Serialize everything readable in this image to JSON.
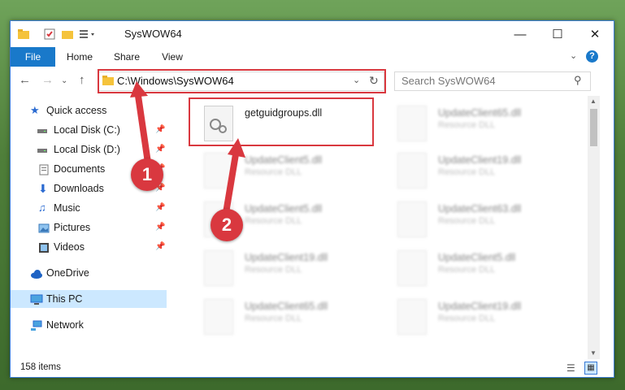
{
  "window": {
    "title": "SysWOW64"
  },
  "ribbon": {
    "tabs": [
      "File",
      "Home",
      "Share",
      "View"
    ]
  },
  "address": {
    "path": "C:\\Windows\\SysWOW64"
  },
  "search": {
    "placeholder": "Search SysWOW64"
  },
  "sidebar": {
    "items": [
      {
        "label": "Quick access",
        "icon": "star-icon",
        "pinned": false
      },
      {
        "label": "Local Disk (C:)",
        "icon": "drive-icon",
        "pinned": true
      },
      {
        "label": "Local Disk (D:)",
        "icon": "drive-icon",
        "pinned": true
      },
      {
        "label": "Documents",
        "icon": "document-icon",
        "pinned": true
      },
      {
        "label": "Downloads",
        "icon": "download-icon",
        "pinned": true
      },
      {
        "label": "Music",
        "icon": "music-icon",
        "pinned": true
      },
      {
        "label": "Pictures",
        "icon": "pictures-icon",
        "pinned": true
      },
      {
        "label": "Videos",
        "icon": "videos-icon",
        "pinned": true
      },
      {
        "label": "OneDrive",
        "icon": "cloud-icon",
        "pinned": false
      },
      {
        "label": "This PC",
        "icon": "computer-icon",
        "pinned": false,
        "selected": true
      },
      {
        "label": "Network",
        "icon": "network-icon",
        "pinned": false
      }
    ]
  },
  "files": {
    "main": {
      "name": "getguidgroups.dll"
    },
    "others": [
      {
        "name": "UpdateClient65.dll",
        "type": "Resource DLL"
      },
      {
        "name": "UpdateClient5.dll",
        "type": "Resource DLL"
      },
      {
        "name": "UpdateClient19.dll",
        "type": "Resource DLL"
      },
      {
        "name": "UpdateClient5.dll",
        "type": "Resource DLL"
      },
      {
        "name": "UpdateClient63.dll",
        "type": "Resource DLL"
      },
      {
        "name": "UpdateClient19.dll",
        "type": "Resource DLL"
      },
      {
        "name": "UpdateClient5.dll",
        "type": "Resource DLL"
      },
      {
        "name": "UpdateClient65.dll",
        "type": "Resource DLL"
      },
      {
        "name": "UpdateClient19.dll",
        "type": "Resource DLL"
      }
    ]
  },
  "annotations": {
    "step1": "1",
    "step2": "2"
  },
  "status": {
    "item_count": "158 items"
  },
  "colors": {
    "accent": "#1979ca",
    "highlight": "#d9383f"
  }
}
